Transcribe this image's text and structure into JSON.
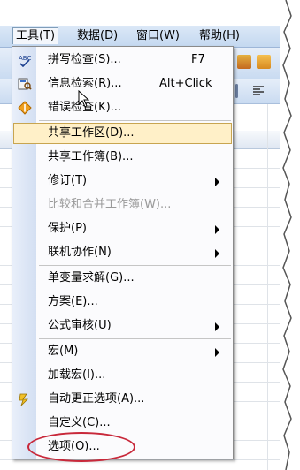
{
  "menubar": {
    "items": [
      {
        "label": "工具(T)"
      },
      {
        "label": "数据(D)"
      },
      {
        "label": "窗口(W)"
      },
      {
        "label": "帮助(H)"
      }
    ]
  },
  "menu": {
    "items": [
      {
        "label": "拼写检查(S)...",
        "shortcut": "F7",
        "icon": "spelling-icon"
      },
      {
        "label": "信息检索(R)...",
        "shortcut": "Alt+Click",
        "icon": "research-icon"
      },
      {
        "label": "错误检查(K)...",
        "icon": "error-check-icon"
      },
      {
        "label": "共享工作区(D)...",
        "highlighted": true
      },
      {
        "label": "共享工作簿(B)..."
      },
      {
        "label": "修订(T)",
        "submenu": true
      },
      {
        "label": "比较和合并工作簿(W)...",
        "disabled": true
      },
      {
        "label": "保护(P)",
        "submenu": true
      },
      {
        "label": "联机协作(N)",
        "submenu": true
      },
      {
        "label": "单变量求解(G)..."
      },
      {
        "label": "方案(E)..."
      },
      {
        "label": "公式审核(U)",
        "submenu": true
      },
      {
        "label": "宏(M)",
        "submenu": true
      },
      {
        "label": "加载宏(I)..."
      },
      {
        "label": "自动更正选项(A)...",
        "icon": "autocorrect-icon"
      },
      {
        "label": "自定义(C)..."
      },
      {
        "label": "选项(O)...",
        "circled": true
      }
    ]
  },
  "colors": {
    "highlight_bg": "#fff0c8",
    "highlight_border": "#c8a550",
    "annotation_circle": "#c8283a",
    "menu_gutter": "#d3dff2"
  }
}
